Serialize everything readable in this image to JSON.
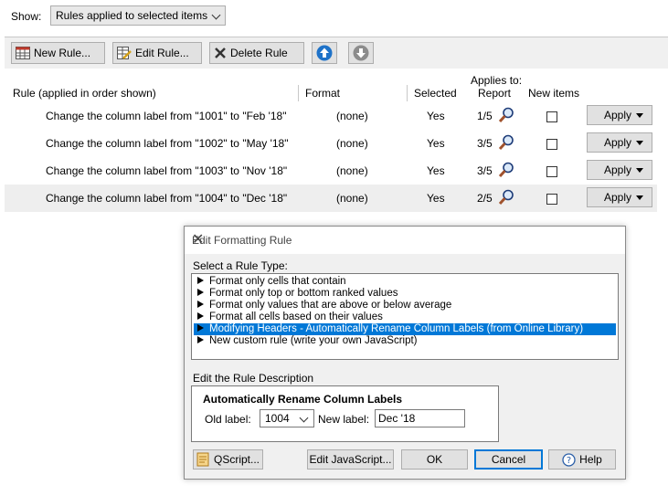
{
  "show": {
    "label": "Show:",
    "selected": "Rules applied to selected items"
  },
  "toolbar": {
    "new_rule": "New Rule...",
    "edit_rule": "Edit Rule...",
    "delete_rule": "Delete Rule"
  },
  "table": {
    "headers": {
      "rule": "Rule (applied in order shown)",
      "format": "Format",
      "selected": "Selected",
      "applies_to": "Applies to:",
      "report": "Report",
      "new_items": "New items"
    },
    "rows": [
      {
        "rule": "Change the column label from \"1001\" to \"Feb '18\"",
        "format": "(none)",
        "selected": "Yes",
        "report": "1/5",
        "apply": "Apply"
      },
      {
        "rule": "Change the column label from \"1002\" to \"May '18\"",
        "format": "(none)",
        "selected": "Yes",
        "report": "3/5",
        "apply": "Apply"
      },
      {
        "rule": "Change the column label from \"1003\" to \"Nov '18\"",
        "format": "(none)",
        "selected": "Yes",
        "report": "3/5",
        "apply": "Apply"
      },
      {
        "rule": "Change the column label from \"1004\" to \"Dec '18\"",
        "format": "(none)",
        "selected": "Yes",
        "report": "2/5",
        "apply": "Apply"
      }
    ]
  },
  "dialog": {
    "title": "Edit Formatting Rule",
    "select_rule_type": "Select a Rule Type:",
    "rule_types": [
      "Format only cells that contain",
      "Format only top or bottom ranked values",
      "Format only values that are above or below average",
      "Format all cells based on their values",
      "Modifying Headers - Automatically Rename Column Labels (from Online Library)",
      "New custom rule (write your own JavaScript)"
    ],
    "selected_rule_type_index": 4,
    "edit_description": "Edit the Rule Description",
    "group_title": "Automatically Rename Column Labels",
    "old_label": "Old label:",
    "old_label_value": "1004",
    "new_label": "New label:",
    "new_label_value": "Dec '18",
    "buttons": {
      "qscript": "QScript...",
      "edit_javascript": "Edit JavaScript...",
      "ok": "OK",
      "cancel": "Cancel",
      "help": "Help"
    }
  },
  "colors": {
    "accent": "#0078d7",
    "selection": "#0078d7",
    "up_button": "#1e72c8",
    "down_button": "#8c8c8c"
  }
}
